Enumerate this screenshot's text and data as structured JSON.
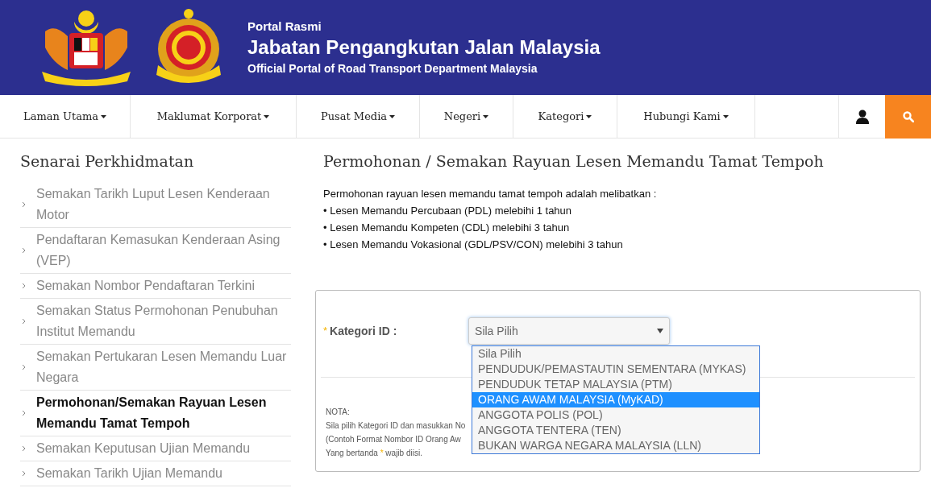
{
  "header": {
    "kicker": "Portal Rasmi",
    "title": "Jabatan Pengangkutan Jalan Malaysia",
    "subtitle": "Official Portal of Road Transport Department Malaysia"
  },
  "nav": [
    {
      "label": "Laman Utama"
    },
    {
      "label": "Maklumat Korporat"
    },
    {
      "label": "Pusat Media"
    },
    {
      "label": "Negeri"
    },
    {
      "label": "Kategori"
    },
    {
      "label": "Hubungi Kami"
    }
  ],
  "sidebar": {
    "title": "Senarai Perkhidmatan",
    "items": [
      {
        "label": "Semakan Tarikh Luput Lesen Kenderaan Motor",
        "selected": false
      },
      {
        "label": "Pendaftaran Kemasukan Kenderaan Asing (VEP)",
        "selected": false
      },
      {
        "label": "Semakan Nombor Pendaftaran Terkini",
        "selected": false
      },
      {
        "label": "Semakan Status Permohonan Penubuhan Institut Memandu",
        "selected": false
      },
      {
        "label": "Semakan Pertukaran Lesen Memandu Luar Negara",
        "selected": false
      },
      {
        "label": "Permohonan/Semakan Rayuan Lesen Memandu Tamat Tempoh",
        "selected": true
      },
      {
        "label": "Semakan Keputusan Ujian Memandu",
        "selected": false
      },
      {
        "label": "Semakan Tarikh Ujian Memandu",
        "selected": false
      }
    ]
  },
  "main": {
    "title": "Permohonan / Semakan Rayuan Lesen Memandu Tamat Tempoh",
    "intro": "Permohonan rayuan lesen memandu tamat tempoh adalah melibatkan :",
    "bullets": [
      "• Lesen Memandu Percubaan (PDL) melebihi 1 tahun",
      "• Lesen Memandu Kompeten (CDL) melebihi 3 tahun",
      "• Lesen Memandu Vokasional (GDL/PSV/CON) melebihi 3 tahun"
    ]
  },
  "form": {
    "required_mark": "*",
    "label": "Kategori ID :",
    "select_value": "Sila Pilih",
    "options": [
      {
        "label": "Sila Pilih",
        "selected": false
      },
      {
        "label": "PENDUDUK/PEMASTAUTIN SEMENTARA (MYKAS)",
        "selected": false
      },
      {
        "label": "PENDUDUK TETAP MALAYSIA (PTM)",
        "selected": false
      },
      {
        "label": "ORANG AWAM MALAYSIA (MyKAD)",
        "selected": true
      },
      {
        "label": "ANGGOTA POLIS (POL)",
        "selected": false
      },
      {
        "label": "ANGGOTA TENTERA (TEN)",
        "selected": false
      },
      {
        "label": "BUKAN WARGA NEGARA MALAYSIA (LLN)",
        "selected": false
      }
    ],
    "note_title": "NOTA:",
    "note_lines": [
      "Sila pilih Kategori ID dan masukkan No",
      "(Contoh Format Nombor ID Orang Aw"
    ],
    "note_required_before": "Yang bertanda",
    "note_required_mark": "*",
    "note_required_after": "wajib diisi."
  }
}
